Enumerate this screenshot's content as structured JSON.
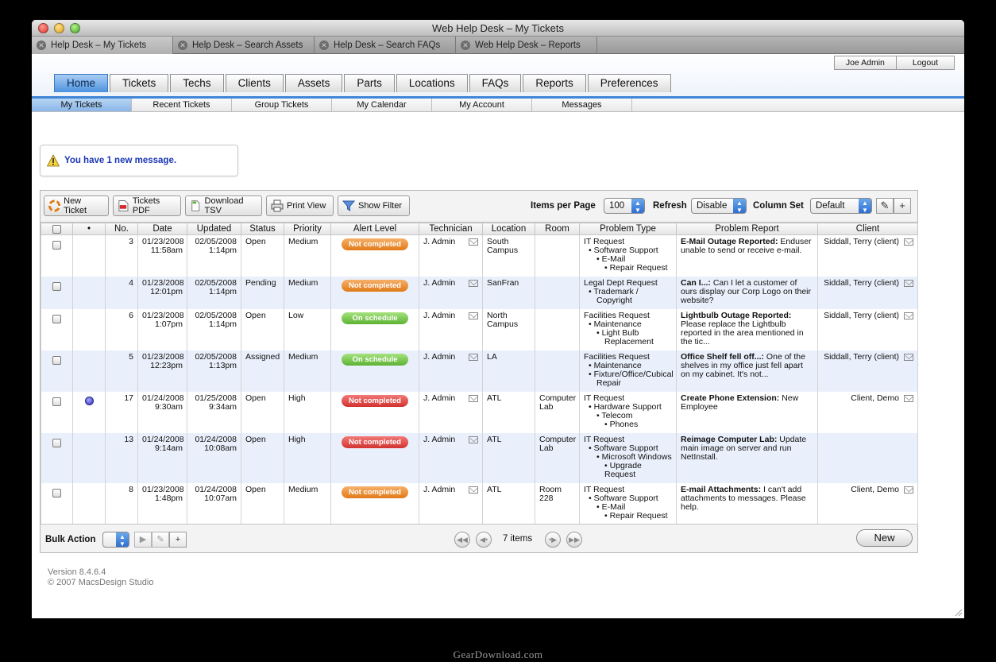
{
  "window": {
    "title": "Web Help Desk – My Tickets"
  },
  "browser_tabs": [
    {
      "label": "Help Desk – My Tickets",
      "active": true
    },
    {
      "label": "Help Desk – Search Assets",
      "active": false
    },
    {
      "label": "Help Desk – Search FAQs",
      "active": false
    },
    {
      "label": "Web Help Desk – Reports",
      "active": false
    }
  ],
  "user": {
    "name": "Joe Admin",
    "logout": "Logout"
  },
  "main_tabs": [
    "Home",
    "Tickets",
    "Techs",
    "Clients",
    "Assets",
    "Parts",
    "Locations",
    "FAQs",
    "Reports",
    "Preferences"
  ],
  "sub_tabs": [
    "My Tickets",
    "Recent Tickets",
    "Group Tickets",
    "My Calendar",
    "My Account",
    "Messages"
  ],
  "message": "You have 1 new message.",
  "toolbar": {
    "new_ticket": "New Ticket",
    "tickets_pdf": "Tickets PDF",
    "download_tsv": "Download TSV",
    "print_view": "Print View",
    "show_filter": "Show Filter",
    "items_per_page_label": "Items per Page",
    "items_per_page_value": "100",
    "refresh_label": "Refresh",
    "refresh_value": "Disable",
    "column_set_label": "Column Set",
    "column_set_value": "Default"
  },
  "columns": [
    "",
    "•",
    "No.",
    "Date",
    "Updated",
    "Status",
    "Priority",
    "Alert Level",
    "Technician",
    "Location",
    "Room",
    "Problem Type",
    "Problem Report",
    "Client"
  ],
  "rows": [
    {
      "no": "3",
      "date": [
        "01/23/2008",
        "11:58am"
      ],
      "updated": [
        "02/05/2008",
        "1:14pm"
      ],
      "status": "Open",
      "priority": "Medium",
      "alert": "Not completed",
      "alert_color": "orange",
      "tech": "J. Admin",
      "location": [
        "South",
        "Campus"
      ],
      "room": [],
      "ptype": [
        [
          "IT Request",
          0
        ],
        [
          "• Software Support",
          1
        ],
        [
          "• E-Mail",
          2
        ],
        [
          "• Repair Request",
          3
        ]
      ],
      "report_title": "E-Mail Outage Reported:",
      "report_body": " Enduser unable to send or receive e-mail.",
      "client": "Siddall, Terry (client)",
      "dot": false
    },
    {
      "no": "4",
      "date": [
        "01/23/2008",
        "12:01pm"
      ],
      "updated": [
        "02/05/2008",
        "1:14pm"
      ],
      "status": "Pending",
      "priority": "Medium",
      "alert": "Not completed",
      "alert_color": "orange",
      "tech": "J. Admin",
      "location": [
        "SanFran"
      ],
      "room": [],
      "ptype": [
        [
          "Legal Dept Request",
          0
        ],
        [
          "• Trademark /",
          1
        ],
        [
          "Copyright",
          2
        ]
      ],
      "report_title": "Can I...:",
      "report_body": " Can I let a customer of ours display our Corp Logo on their website?",
      "client": "Siddall, Terry (client)",
      "dot": false
    },
    {
      "no": "6",
      "date": [
        "01/23/2008",
        "1:07pm"
      ],
      "updated": [
        "02/05/2008",
        "1:14pm"
      ],
      "status": "Open",
      "priority": "Low",
      "alert": "On schedule",
      "alert_color": "green",
      "tech": "J. Admin",
      "location": [
        "North",
        "Campus"
      ],
      "room": [],
      "ptype": [
        [
          "Facilities Request",
          0
        ],
        [
          "• Maintenance",
          1
        ],
        [
          "• Light Bulb",
          2
        ],
        [
          "Replacement",
          3
        ]
      ],
      "report_title": "Lightbulb Outage Reported:",
      "report_body": " Please replace the Lightbulb reported in the area mentioned in the tic...",
      "client": "Siddall, Terry (client)",
      "dot": false
    },
    {
      "no": "5",
      "date": [
        "01/23/2008",
        "12:23pm"
      ],
      "updated": [
        "02/05/2008",
        "1:13pm"
      ],
      "status": "Assigned",
      "priority": "Medium",
      "alert": "On schedule",
      "alert_color": "green",
      "tech": "J. Admin",
      "location": [
        "LA"
      ],
      "room": [],
      "ptype": [
        [
          "Facilities Request",
          0
        ],
        [
          "• Maintenance",
          1
        ],
        [
          "• Fixture/Office/Cubical",
          1
        ],
        [
          "Repair",
          2
        ]
      ],
      "report_title": "Office Shelf fell off...:",
      "report_body": " One of the shelves in my office just fell apart on my cabinet. It's not...",
      "client": "Siddall, Terry (client)",
      "dot": false
    },
    {
      "no": "17",
      "date": [
        "01/24/2008",
        "9:30am"
      ],
      "updated": [
        "01/25/2008",
        "9:34am"
      ],
      "status": "Open",
      "priority": "High",
      "alert": "Not completed",
      "alert_color": "red",
      "tech": "J. Admin",
      "location": [
        "ATL"
      ],
      "room": [
        "Computer",
        "Lab"
      ],
      "ptype": [
        [
          "IT Request",
          0
        ],
        [
          "• Hardware Support",
          1
        ],
        [
          "• Telecom",
          2
        ],
        [
          "• Phones",
          3
        ]
      ],
      "report_title": "Create Phone Extension:",
      "report_body": " New Employee",
      "client": "Client, Demo",
      "dot": true
    },
    {
      "no": "13",
      "date": [
        "01/24/2008",
        "9:14am"
      ],
      "updated": [
        "01/24/2008",
        "10:08am"
      ],
      "status": "Open",
      "priority": "High",
      "alert": "Not completed",
      "alert_color": "red",
      "tech": "J. Admin",
      "location": [
        "ATL"
      ],
      "room": [
        "Computer",
        "Lab"
      ],
      "ptype": [
        [
          "IT Request",
          0
        ],
        [
          "• Software Support",
          1
        ],
        [
          "• Microsoft Windows",
          2
        ],
        [
          "• Upgrade",
          3
        ],
        [
          "Request",
          3
        ]
      ],
      "report_title": "Reimage Computer Lab:",
      "report_body": " Update main image on server and run NetInstall.",
      "client": "",
      "dot": false
    },
    {
      "no": "8",
      "date": [
        "01/23/2008",
        "1:48pm"
      ],
      "updated": [
        "01/24/2008",
        "10:07am"
      ],
      "status": "Open",
      "priority": "Medium",
      "alert": "Not completed",
      "alert_color": "orange",
      "tech": "J. Admin",
      "location": [
        "ATL"
      ],
      "room": [
        "Room",
        "228"
      ],
      "ptype": [
        [
          "IT Request",
          0
        ],
        [
          "• Software Support",
          1
        ],
        [
          "• E-Mail",
          2
        ],
        [
          "• Repair Request",
          3
        ]
      ],
      "report_title": "E-mail Attachments:",
      "report_body": " I can't add attachments to messages. Please help.",
      "client": "Client, Demo",
      "dot": false
    }
  ],
  "bottom": {
    "bulk_action": "Bulk Action",
    "items_count": "7 items",
    "new_button": "New"
  },
  "footer": {
    "version": "Version 8.4.6.4",
    "copyright": "© 2007 MacsDesign Studio"
  },
  "watermark": "GearDownload.com",
  "colors": {
    "accent_blue": "#4d92df",
    "link_blue": "#1a37b5",
    "alert_orange": "#e07a18",
    "alert_red": "#d2322f",
    "alert_green": "#5db234"
  }
}
